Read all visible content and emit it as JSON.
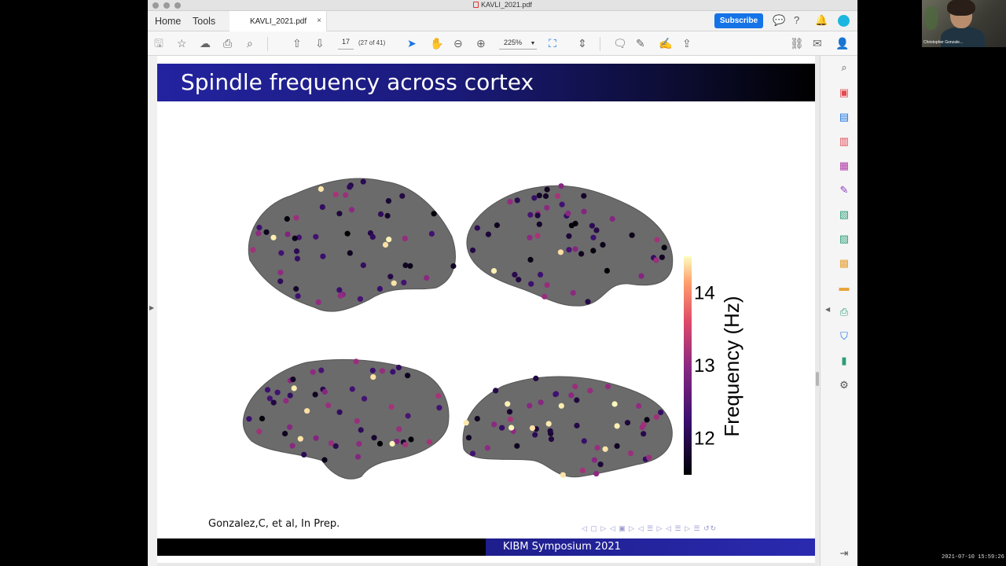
{
  "window": {
    "title": "KAVLI_2021.pdf"
  },
  "tabbar": {
    "home": "Home",
    "tools": "Tools",
    "doc_tab": "KAVLI_2021.pdf",
    "doc_close": "×",
    "subscribe": "Subscribe"
  },
  "toolbar": {
    "page_current": "17",
    "page_count": "(27 of 41)",
    "zoom": "225%"
  },
  "slide": {
    "title": "Spindle frequency across cortex",
    "citation": "Gonzalez,C, et al, In Prep.",
    "footer": "KIBM Symposium 2021",
    "nav": "◁ ▢ ▷ ◁ ▣ ▷ ◁ ☰ ▷ ◁ ☰ ▷ ☰ ↺↻"
  },
  "chart_data": {
    "type": "scatter",
    "title": "",
    "colorbar": {
      "label": "Frequency (Hz)",
      "ticks": [
        "12",
        "13",
        "14"
      ],
      "range": [
        11.5,
        14.5
      ],
      "colormap": "magma"
    },
    "panels": [
      "lateral left",
      "lateral right",
      "medial left",
      "medial right"
    ],
    "colors": {
      "brain": "#6b6b6b",
      "low": "#000004",
      "mid": "#b73779",
      "high": "#fcfdbf"
    }
  },
  "webcam": {
    "name": "Christopher Gonzale..."
  },
  "timestamp": "2021-07-10 15:59:26"
}
